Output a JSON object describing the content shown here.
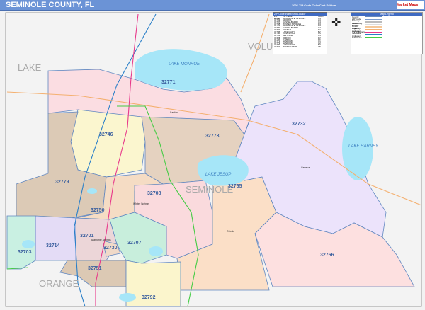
{
  "header": {
    "title": "SEMINOLE COUNTY, FL",
    "edition": "2026 ZIP Code ColorCast Edition",
    "logo": "Market Maps"
  },
  "counties": [
    "LAKE",
    "VOLUSIA",
    "SEMINOLE",
    "ORANGE"
  ],
  "lakes": [
    "LAKE MONROE",
    "LAKE JESUP",
    "LAKE HARNEY"
  ],
  "zip_labels": [
    "32771",
    "32746",
    "32773",
    "32779",
    "32708",
    "32765",
    "32732",
    "32750",
    "32701",
    "32707",
    "32714",
    "32703",
    "32730",
    "32751",
    "32766",
    "32792"
  ],
  "places": [
    "Sanford",
    "Winter Springs",
    "Altamonte Springs",
    "Oviedo",
    "Geneva"
  ],
  "index": {
    "title": "ZIP Code Index/Grid Locator",
    "columns": [
      "ZIP Code",
      "ZIP Name",
      "GRID"
    ],
    "rows": [
      [
        "32701",
        "ALTAMONTE SPRINGS",
        "C4"
      ],
      [
        "32703",
        "APOPKA",
        "A4"
      ],
      [
        "32707",
        "CASSELBERRY",
        "C4"
      ],
      [
        "32708",
        "WINTER SPRINGS",
        "D3"
      ],
      [
        "32714",
        "ALTAMONTE SPRINGS",
        "B4"
      ],
      [
        "32730",
        "CASSELBERRY",
        "C4"
      ],
      [
        "32732",
        "GENEVA",
        "F2"
      ],
      [
        "32746",
        "LAKE MARY",
        "B2"
      ],
      [
        "32750",
        "LONGWOOD",
        "C3"
      ],
      [
        "32751",
        "MAITLAND",
        "C5"
      ],
      [
        "32765",
        "OVIEDO",
        "D3"
      ],
      [
        "32766",
        "OVIEDO",
        "F4"
      ],
      [
        "32771",
        "SANFORD",
        "C1"
      ],
      [
        "32773",
        "SANFORD",
        "C2"
      ],
      [
        "32779",
        "LONGWOOD",
        "B3"
      ],
      [
        "32792",
        "WINTER PARK",
        "C5"
      ]
    ]
  },
  "legend": {
    "title": "Map Legend",
    "items": [
      {
        "label": "County",
        "color": "#6688bb"
      },
      {
        "label": "ZIP Code",
        "color": "#7799cc"
      },
      {
        "label": "Primary Roads",
        "color": "#bbbbbb"
      },
      {
        "label": "Secondary Roads",
        "color": "#dddddd"
      },
      {
        "label": "County Highways",
        "color": "#f4c89a"
      },
      {
        "label": "State Highways",
        "color": "#f4b070"
      },
      {
        "label": "US Highways",
        "color": "#e8388a"
      },
      {
        "label": "Interstate Highways",
        "color": "#2a7fc8"
      },
      {
        "label": "Toll Roads",
        "color": "#44cc44"
      }
    ]
  },
  "colors": {
    "water": "#a6e6f8",
    "border": "#5f86c0",
    "header": "#6b93d6"
  }
}
